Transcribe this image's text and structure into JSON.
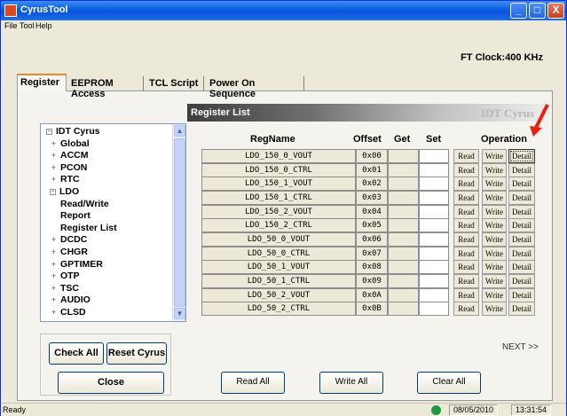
{
  "app": {
    "title": "CyrusTool",
    "window_buttons": [
      "_",
      "□",
      "X"
    ]
  },
  "menu": [
    "File",
    "Tool",
    "Help"
  ],
  "ft_clock": "FT Clock:400 KHz",
  "tabs": [
    {
      "label": "Register",
      "active": true
    },
    {
      "label": "EEPROM Access",
      "active": false
    },
    {
      "label": "TCL Script",
      "active": false
    },
    {
      "label": "Power On Sequence",
      "active": false
    }
  ],
  "tree": {
    "collapse_symbol": "−",
    "expand_symbol": "+",
    "items": [
      {
        "label": "IDT Cyrus",
        "indent": 0,
        "toggle": "minus"
      },
      {
        "label": "Global",
        "indent": 1,
        "toggle": "plus"
      },
      {
        "label": "ACCM",
        "indent": 1,
        "toggle": "plus"
      },
      {
        "label": "PCON",
        "indent": 1,
        "toggle": "plus"
      },
      {
        "label": "RTC",
        "indent": 1,
        "toggle": "plus"
      },
      {
        "label": "LDO",
        "indent": 1,
        "toggle": "minus"
      },
      {
        "label": "Read/Write",
        "indent": 2,
        "toggle": "none"
      },
      {
        "label": "Report",
        "indent": 2,
        "toggle": "none"
      },
      {
        "label": "Register List",
        "indent": 2,
        "toggle": "none"
      },
      {
        "label": "DCDC",
        "indent": 1,
        "toggle": "plus"
      },
      {
        "label": "CHGR",
        "indent": 1,
        "toggle": "plus"
      },
      {
        "label": "GPTIMER",
        "indent": 1,
        "toggle": "plus"
      },
      {
        "label": "OTP",
        "indent": 1,
        "toggle": "plus"
      },
      {
        "label": "TSC",
        "indent": 1,
        "toggle": "plus"
      },
      {
        "label": "AUDIO",
        "indent": 1,
        "toggle": "plus"
      },
      {
        "label": "CLSD",
        "indent": 1,
        "toggle": "plus"
      }
    ],
    "scroll_up": "▲",
    "scroll_down": "▼"
  },
  "left_buttons": {
    "check_all": "Check All",
    "reset_cyrus": "Reset Cyrus",
    "close": "Close"
  },
  "register_list": {
    "header": "Register List",
    "brand": "IDT Cyrus",
    "columns": {
      "regname": "RegName",
      "offset": "Offset",
      "get": "Get",
      "set": "Set",
      "operation": "Operation"
    },
    "rows": [
      {
        "name": "LDO_150_0_VOUT",
        "offset": "0x00",
        "get": "",
        "set": ""
      },
      {
        "name": "LDO_150_0_CTRL",
        "offset": "0x01",
        "get": "",
        "set": ""
      },
      {
        "name": "LDO_150_1_VOUT",
        "offset": "0x02",
        "get": "",
        "set": ""
      },
      {
        "name": "LDO_150_1_CTRL",
        "offset": "0x03",
        "get": "",
        "set": ""
      },
      {
        "name": "LDO_150_2_VOUT",
        "offset": "0x04",
        "get": "",
        "set": ""
      },
      {
        "name": "LDO_150_2_CTRL",
        "offset": "0x05",
        "get": "",
        "set": ""
      },
      {
        "name": "LDO_50_0_VOUT",
        "offset": "0x06",
        "get": "",
        "set": ""
      },
      {
        "name": "LDO_50_0_CTRL",
        "offset": "0x07",
        "get": "",
        "set": ""
      },
      {
        "name": "LDO_50_1_VOUT",
        "offset": "0x08",
        "get": "",
        "set": ""
      },
      {
        "name": "LDO_50_1_CTRL",
        "offset": "0x09",
        "get": "",
        "set": ""
      },
      {
        "name": "LDO_50_2_VOUT",
        "offset": "0x0A",
        "get": "",
        "set": ""
      },
      {
        "name": "LDO_50_2_CTRL",
        "offset": "0x0B",
        "get": "",
        "set": ""
      }
    ],
    "op_labels": {
      "read": "Read",
      "write": "Write",
      "detail": "Detail"
    },
    "next": "NEXT >>",
    "bottom_buttons": {
      "read_all": "Read All",
      "write_all": "Write All",
      "clear_all": "Clear All"
    }
  },
  "status": {
    "ready": "Ready",
    "date": "08/05/2010",
    "time": "13:31:54",
    "indicator_color": "#1f9c40"
  },
  "colors": {
    "titlebar": "#0a5ee0",
    "arrow": "#e8200c",
    "active_tab_accent": "#e68b2c"
  }
}
